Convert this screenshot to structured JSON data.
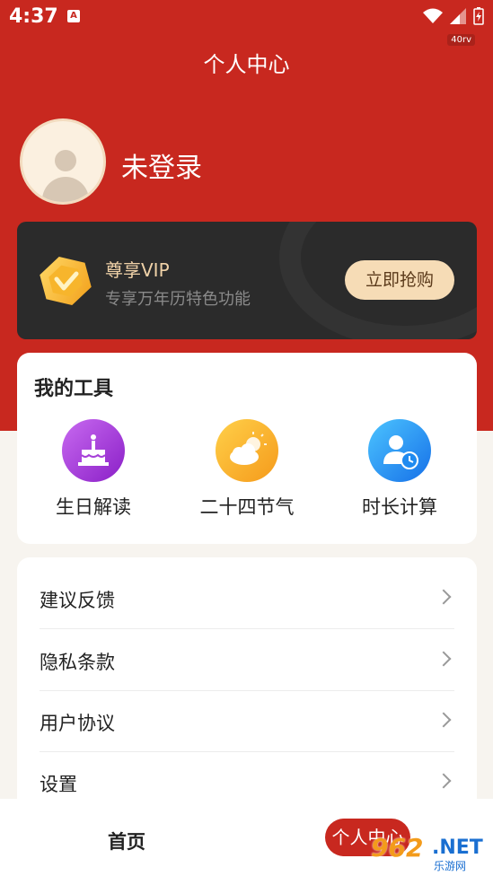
{
  "status_bar": {
    "time": "4:37",
    "a_icon": "A",
    "network_badge": "40rv"
  },
  "header": {
    "title": "个人中心"
  },
  "profile": {
    "login_status": "未登录"
  },
  "vip": {
    "title": "尊享VIP",
    "description": "专享万年历特色功能",
    "button_label": "立即抢购"
  },
  "tools": {
    "title": "我的工具",
    "items": [
      {
        "label": "生日解读",
        "icon": "birthday-cake-icon"
      },
      {
        "label": "二十四节气",
        "icon": "sun-cloud-icon"
      },
      {
        "label": "时长计算",
        "icon": "user-clock-icon"
      }
    ]
  },
  "menu": {
    "items": [
      {
        "label": "建议反馈"
      },
      {
        "label": "隐私条款"
      },
      {
        "label": "用户协议"
      },
      {
        "label": "设置"
      }
    ]
  },
  "bottom_nav": {
    "home": "首页",
    "profile": "个人中心"
  },
  "watermark": {
    "number": "962",
    "net": ".NET",
    "sub": "乐游网"
  },
  "colors": {
    "primary_red": "#c8281f",
    "vip_gold": "#f6dcb6"
  }
}
